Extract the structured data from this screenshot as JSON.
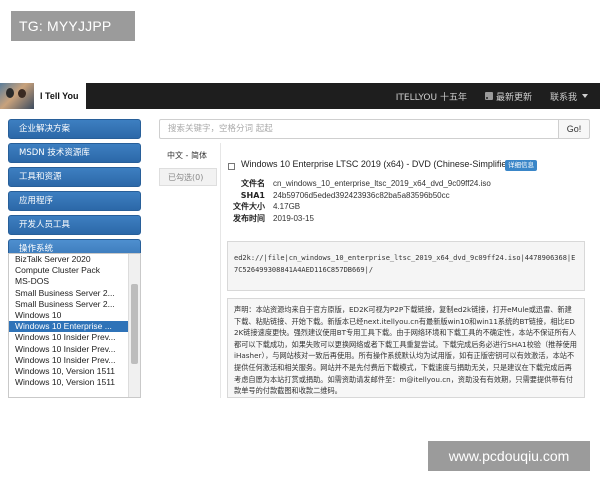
{
  "overlay": {
    "tg_label": "TG: MYYJJPP",
    "watermark": "www.pcdouqiu.com"
  },
  "header": {
    "logo_text": "I Tell You",
    "nav": [
      {
        "label": "ITELLYOU 十五年"
      },
      {
        "label": "最新更新",
        "icon": "rss-icon"
      },
      {
        "label": "联系我",
        "icon": "chevron-down-icon"
      }
    ]
  },
  "sidebar": {
    "categories": [
      {
        "label": "企业解决方案"
      },
      {
        "label": "MSDN 技术资源库"
      },
      {
        "label": "工具和资源"
      },
      {
        "label": "应用程序"
      },
      {
        "label": "开发人员工具"
      },
      {
        "label": "操作系统"
      }
    ],
    "active_category": "操作系统",
    "products": [
      "BizTalk Server 2020",
      "Compute Cluster Pack",
      "MS-DOS",
      "Small Business Server 2...",
      "Small Business Server 2...",
      "Windows 10",
      "Windows 10 Enterprise ...",
      "Windows 10 Insider Prev...",
      "Windows 10 Insider Prev...",
      "Windows 10 Insider Prev...",
      "Windows 10, Version 1511",
      "Windows 10, Version 1511"
    ],
    "selected_product": "Windows 10 Enterprise ..."
  },
  "search": {
    "placeholder": "搜索关键字，空格分词 起起",
    "button_label": "Go!"
  },
  "languages": {
    "active": "中文 - 简体",
    "checked_tab": "已勾选(0)"
  },
  "entry": {
    "title": "Windows 10 Enterprise LTSC 2019 (x64) - DVD (Chinese-Simplified)",
    "details_badge": "详细信息",
    "fields": [
      {
        "key": "文件名",
        "value": "cn_windows_10_enterprise_ltsc_2019_x64_dvd_9c09ff24.iso"
      },
      {
        "key": "SHA1",
        "value": "24b59706d5eded392423936c82ba5a83596b50cc"
      },
      {
        "key": "文件大小",
        "value": "4.17GB"
      },
      {
        "key": "发布时间",
        "value": "2019-03-15"
      }
    ],
    "ed2k_link": "ed2k://|file|cn_windows_10_enterprise_ltsc_2019_x64_dvd_9c09ff24.iso|4478906368|E7C526499308841A4AED116C857DB669|/",
    "notice": "声明：本站资源均来自于官方原版，ED2K可视为P2P下载链接，复制ed2k链接，打开eMule或迅雷、新建下载、粘贴链接、开始下载。新版本已经next.itellyou.cn有最新版win10和win11系统的BT链接，相比ED2K链接速度更快。强烈建议使用BT专用工具下载。由于网络环境和下载工具的不确定性，本站不保证所有人都可以下载成功，如果失败可以更换网络或者下载工具重复尝试。下载完成后务必进行SHA1校验（推荐使用iHasher），与网站核对一致后再使用。所有操作系统默认均为试用版，如有正版密钥可以有效激活，本站不提供任何激活和相关服务。网站并不是先付费后下载模式，下载速度与捐助无关，只是建议在下载完成后再考虑自愿为本站打赏或捐助。如需资助请发邮件至：m@itellyou.cn，资助没有有效期，只需要提供带有付款单号的付款截图和收款二维码。"
  }
}
